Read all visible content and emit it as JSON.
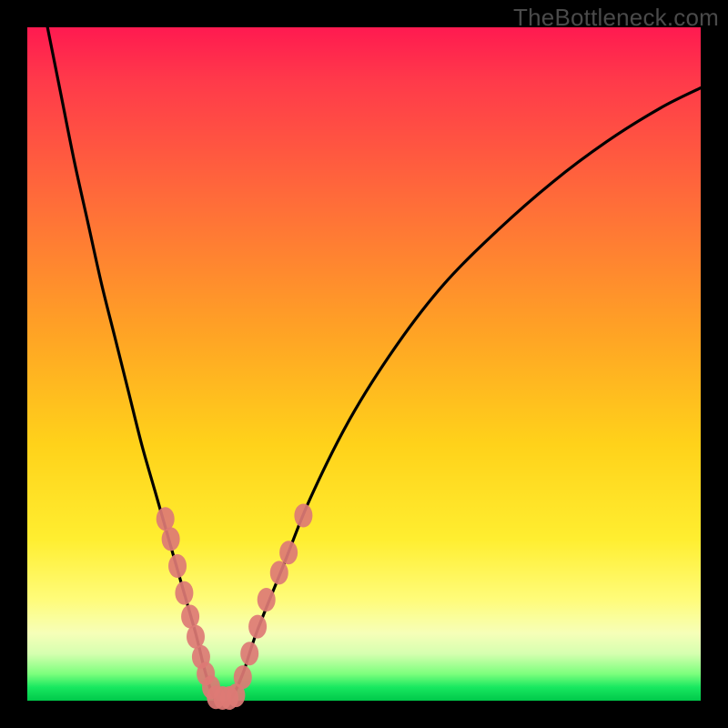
{
  "watermark": "TheBottleneck.com",
  "chart_data": {
    "type": "line",
    "title": "",
    "xlabel": "",
    "ylabel": "",
    "xlim": [
      0,
      100
    ],
    "ylim": [
      0,
      100
    ],
    "grid": false,
    "legend": false,
    "annotations": [],
    "series": [
      {
        "name": "bottleneck-curve",
        "x": [
          3,
          5,
          7,
          9,
          11,
          13,
          15,
          17,
          19,
          21,
          23,
          25,
          26.5,
          28,
          30,
          32,
          34,
          38,
          42,
          48,
          55,
          62,
          70,
          78,
          86,
          94,
          100
        ],
        "y": [
          100,
          90,
          80,
          71,
          62,
          54,
          46,
          38,
          31,
          24,
          17,
          10,
          4,
          0,
          0,
          4,
          10,
          20,
          30,
          42,
          53,
          62,
          70,
          77,
          83,
          88,
          91
        ]
      }
    ],
    "markers": [
      {
        "name": "data-points-left",
        "color": "#dd7a75",
        "points": [
          {
            "x": 20.5,
            "y": 27
          },
          {
            "x": 21.3,
            "y": 24
          },
          {
            "x": 22.3,
            "y": 20
          },
          {
            "x": 23.3,
            "y": 16
          },
          {
            "x": 24.2,
            "y": 12.5
          },
          {
            "x": 25.0,
            "y": 9.5
          },
          {
            "x": 25.8,
            "y": 6.5
          },
          {
            "x": 26.5,
            "y": 4
          },
          {
            "x": 27.3,
            "y": 2
          }
        ]
      },
      {
        "name": "data-points-bottom",
        "color": "#dd7a75",
        "points": [
          {
            "x": 28.0,
            "y": 0.5
          },
          {
            "x": 29.0,
            "y": 0.4
          },
          {
            "x": 30.0,
            "y": 0.4
          },
          {
            "x": 31.0,
            "y": 0.8
          }
        ]
      },
      {
        "name": "data-points-right",
        "color": "#dd7a75",
        "points": [
          {
            "x": 32.0,
            "y": 3.5
          },
          {
            "x": 33.0,
            "y": 7
          },
          {
            "x": 34.2,
            "y": 11
          },
          {
            "x": 35.5,
            "y": 15
          },
          {
            "x": 37.4,
            "y": 19
          },
          {
            "x": 38.8,
            "y": 22
          },
          {
            "x": 41.0,
            "y": 27.5
          }
        ]
      }
    ]
  }
}
